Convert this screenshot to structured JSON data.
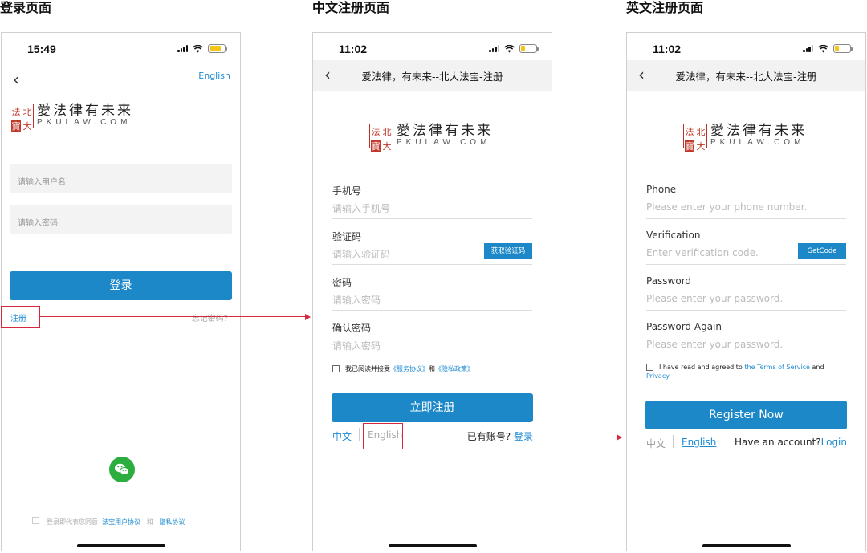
{
  "sections": {
    "login_title": "登录页面",
    "cn_register_title": "中文注册页面",
    "en_register_title": "英文注册页面"
  },
  "logo": {
    "seal_chars": [
      "法",
      "北",
      "寶",
      "大"
    ],
    "cn": "愛法律有未来",
    "en": "PKULAW.COM"
  },
  "login": {
    "time": "15:49",
    "lang_link": "English",
    "username_placeholder": "请输入用户名",
    "password_placeholder": "请输入密码",
    "login_button": "登录",
    "register_link": "注册",
    "forgot_link": "忘记密码?",
    "agree_text": "登录即代表您同意",
    "user_agreement": "法宝用户协议",
    "and": "和",
    "privacy": "隐私协议"
  },
  "cn_register": {
    "time": "11:02",
    "nav_title": "爱法律，有未来--北大法宝-注册",
    "phone_label": "手机号",
    "phone_placeholder": "请输入手机号",
    "code_label": "验证码",
    "code_placeholder": "请输入验证码",
    "code_button": "获取验证码",
    "password_label": "密码",
    "password_placeholder": "请输入密码",
    "confirm_label": "确认密码",
    "confirm_placeholder": "请输入密码",
    "agree_prefix": "我已阅读并接受",
    "service": "《服务协议》",
    "and": "和",
    "privacy": "《隐私政策》",
    "register_button": "立即注册",
    "lang_cn": "中文",
    "lang_en": "English",
    "has_account": "已有账号?",
    "login_link": "登录"
  },
  "en_register": {
    "time": "11:02",
    "nav_title": "爱法律，有未来--北大法宝-注册",
    "phone_label": "Phone",
    "phone_placeholder": "Please enter your phone number.",
    "code_label": "Verification",
    "code_placeholder": "Enter verification code.",
    "code_button": "GetCode",
    "password_label": "Password",
    "password_placeholder": "Please enter your password.",
    "again_label": "Password Again",
    "again_placeholder": "Please enter your password.",
    "agree_prefix": "I have read and agreed to",
    "terms": "the Terms of Service",
    "and": "and",
    "privacy": "Privacy",
    "register_button": "Register Now",
    "lang_cn": "中文",
    "lang_en": "English",
    "has_account": "Have an account?",
    "login_link": "Login"
  },
  "colors": {
    "accent": "#1c88c8",
    "annotation": "#d6283b",
    "battery_charging": "#f5c518",
    "battery_low": "#f5c518"
  }
}
